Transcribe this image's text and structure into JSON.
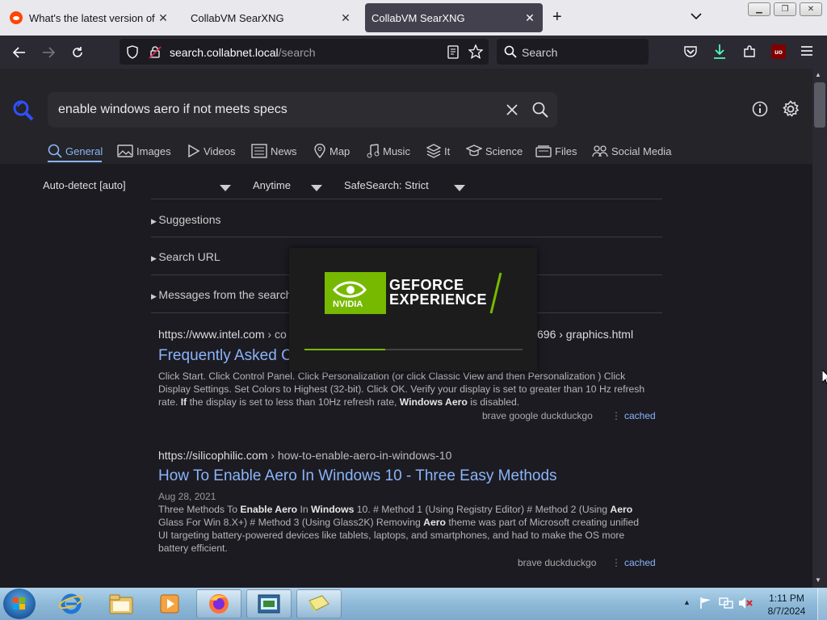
{
  "tabs": [
    {
      "title": "What's the latest version of Gef",
      "active": false
    },
    {
      "title": "CollabVM SearXNG",
      "active": false
    },
    {
      "title": "CollabVM SearXNG",
      "active": true
    }
  ],
  "urlbar": {
    "url_host": "search.collabnet.local",
    "url_path": "/search"
  },
  "searchbar": {
    "placeholder": "Search"
  },
  "search": {
    "query": "enable windows aero if not meets specs"
  },
  "categories": [
    "General",
    "Images",
    "Videos",
    "News",
    "Map",
    "Music",
    "It",
    "Science",
    "Files",
    "Social Media"
  ],
  "filters": {
    "language": "Auto-detect [auto]",
    "time": "Anytime",
    "safesearch": "SafeSearch: Strict"
  },
  "folds": [
    "Suggestions",
    "Search URL",
    "Messages from the search"
  ],
  "results": [
    {
      "url_host": "https://www.intel.com",
      "url_path_prefix": "› co",
      "url_path_suffix": "696 › graphics.html",
      "title": "Frequently Asked C",
      "engines": "brave  google  duckduckgo",
      "cached": "cached"
    },
    {
      "url_host": "https://silicophilic.com",
      "url_path": "› how-to-enable-aero-in-windows-10",
      "title": "How To Enable Aero In Windows 10 - Three Easy Methods",
      "date": "Aug 28, 2021",
      "engines": "brave  duckduckgo",
      "cached": "cached"
    }
  ],
  "popup": {
    "brand": "NVIDIA",
    "line1": "GEFORCE",
    "line2": "EXPERIENCE",
    "progress": 0.37
  },
  "clock": {
    "time": "1:11 PM",
    "date": "8/7/2024"
  },
  "colors": {
    "accent": "#8ab4f8",
    "nvidia_green": "#76b900",
    "toolbar": "#2b2a33"
  }
}
